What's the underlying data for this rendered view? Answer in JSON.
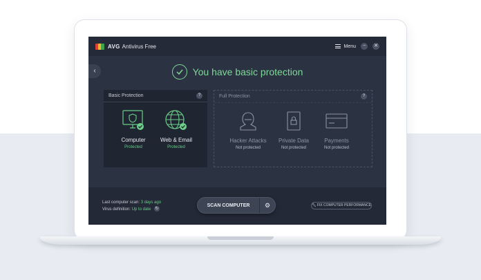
{
  "app": {
    "logo_text": "AVG",
    "product_name": "Antivirus Free",
    "menu_label": "Menu",
    "minimize_glyph": "−",
    "close_glyph": "✕",
    "back_glyph": "‹"
  },
  "headline": {
    "text": "You have basic protection",
    "color": "#7fd89a"
  },
  "basic_panel": {
    "title": "Basic Protection",
    "help": "?",
    "features": [
      {
        "name": "Computer",
        "status": "Protected",
        "icon": "monitor-shield-icon"
      },
      {
        "name": "Web & Email",
        "status": "Protected",
        "icon": "globe-icon"
      }
    ]
  },
  "full_panel": {
    "title": "Full Protection",
    "help": "?",
    "features": [
      {
        "name": "Hacker Attacks",
        "status": "Not protected",
        "icon": "hacker-icon"
      },
      {
        "name": "Private Data",
        "status": "Not protected",
        "icon": "lock-icon"
      },
      {
        "name": "Payments",
        "status": "Not protected",
        "icon": "card-icon"
      }
    ]
  },
  "bottom": {
    "last_scan_label": "Last computer scan:",
    "last_scan_value": "3 days ago",
    "virus_def_label": "Virus definition:",
    "virus_def_value": "Up to date",
    "scan_button": "SCAN COMPUTER",
    "fix_button": "FIX COMPUTER PERFORMANCE"
  },
  "colors": {
    "screen_bg": "#2b3241",
    "accent_green": "#7fd89a",
    "status_green": "#6ccf8a"
  }
}
